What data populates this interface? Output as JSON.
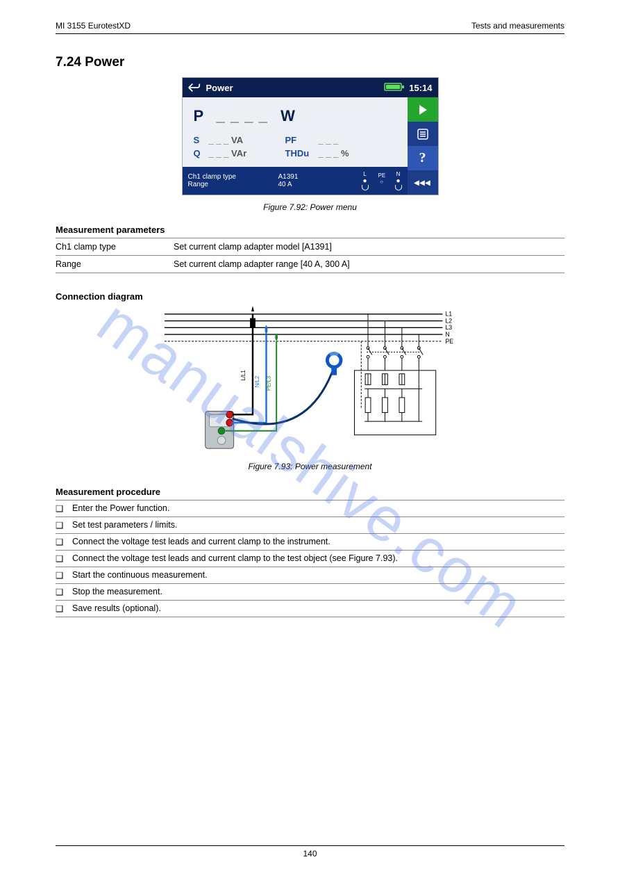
{
  "header": {
    "left": "MI 3155 EurotestXD",
    "right": "Tests and measurements"
  },
  "section_title": "7.24 Power",
  "device": {
    "title": "Power",
    "time": "15:14",
    "P_label": "P",
    "P_value": "_ _ _ _",
    "P_unit": "W",
    "rows": [
      {
        "lab": "S",
        "val": "_ _ _  VA",
        "lab2": "PF",
        "val2": "_ _ _"
      },
      {
        "lab": "Q",
        "val": "_ _ _  VAr",
        "lab2": "THDu",
        "val2": "_ _ _  %"
      }
    ],
    "info": {
      "l1a": "Ch1 clamp type",
      "l1b": "A1391",
      "l2a": "Range",
      "l2b": "40 A"
    },
    "probe_labels": [
      "L",
      "PE",
      "N"
    ],
    "side_labels": {
      "run": "▶",
      "list": "list",
      "help": "?",
      "back": "◂◂◂"
    }
  },
  "fig1_caption": "Figure 7.92: Power menu",
  "params_head": "Measurement parameters",
  "params": [
    {
      "k": "Ch1 clamp type",
      "v": "Set current clamp adapter model [A1391]"
    },
    {
      "k": "Range",
      "v": "Set current clamp adapter range [40 A, 300 A]"
    }
  ],
  "conn_head": "Connection diagram",
  "wiring": {
    "rail_labels": [
      "L1",
      "L2",
      "L3",
      "N",
      "PE"
    ],
    "probe_labels": [
      "L/L1",
      "N/L2",
      "PE/L3"
    ]
  },
  "fig2_caption": "Figure 7.93: Power measurement",
  "proc_head": "Measurement procedure",
  "proc": [
    "Enter the Power function.",
    "Set test parameters / limits.",
    "Connect the voltage test leads and current clamp to the instrument.",
    "Connect the voltage test leads and current clamp to the test object (see Figure 7.93).",
    "Start the continuous measurement.",
    "Stop the measurement.",
    "Save results (optional)."
  ],
  "footer": "140",
  "watermark": "manualshive.com",
  "chart_data": {
    "type": "table",
    "title": "Power screen readout placeholders",
    "rows": [
      {
        "symbol": "P",
        "value": "_ _ _ _",
        "unit": "W"
      },
      {
        "symbol": "S",
        "value": "_ _ _",
        "unit": "VA"
      },
      {
        "symbol": "Q",
        "value": "_ _ _",
        "unit": "VAr"
      },
      {
        "symbol": "PF",
        "value": "_ _ _",
        "unit": ""
      },
      {
        "symbol": "THDu",
        "value": "_ _ _",
        "unit": "%"
      }
    ]
  }
}
